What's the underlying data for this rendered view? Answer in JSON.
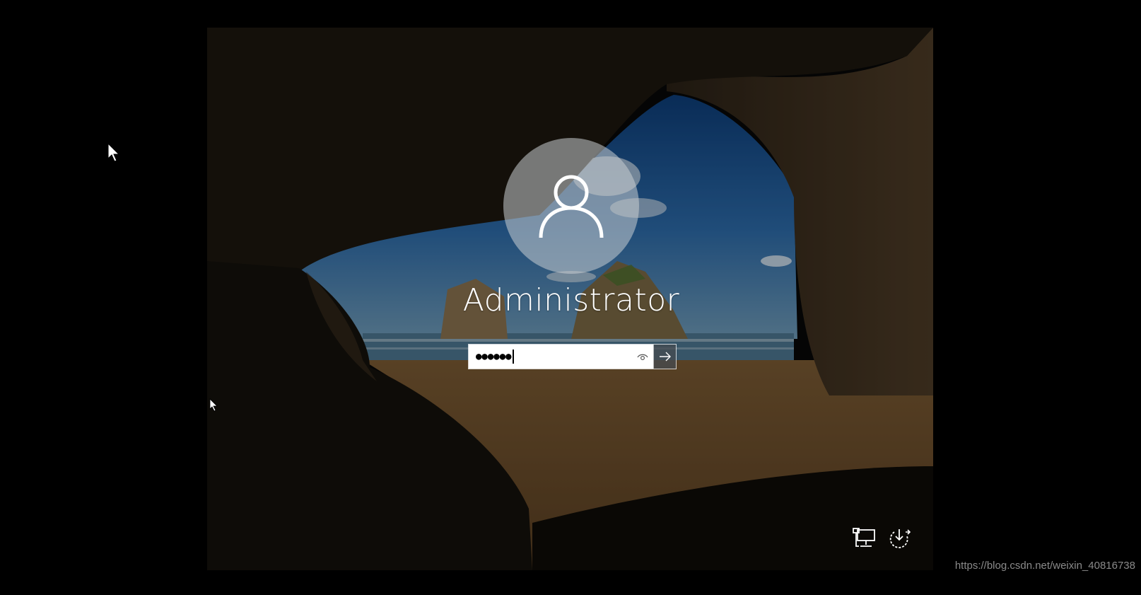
{
  "user": {
    "name": "Administrator"
  },
  "password": {
    "masked_value": "●●●●●●"
  },
  "icons": {
    "avatar": "user-silhouette-icon",
    "reveal": "eye-icon",
    "submit": "arrow-right-icon",
    "network": "network-icon",
    "power": "power-icon"
  },
  "watermark": {
    "text": "https://blog.csdn.net/weixin_40816738"
  },
  "colors": {
    "background": "#000000",
    "avatar_circle": "#c8cdd2",
    "text": "#ffffff",
    "input_background": "#ffffff"
  }
}
